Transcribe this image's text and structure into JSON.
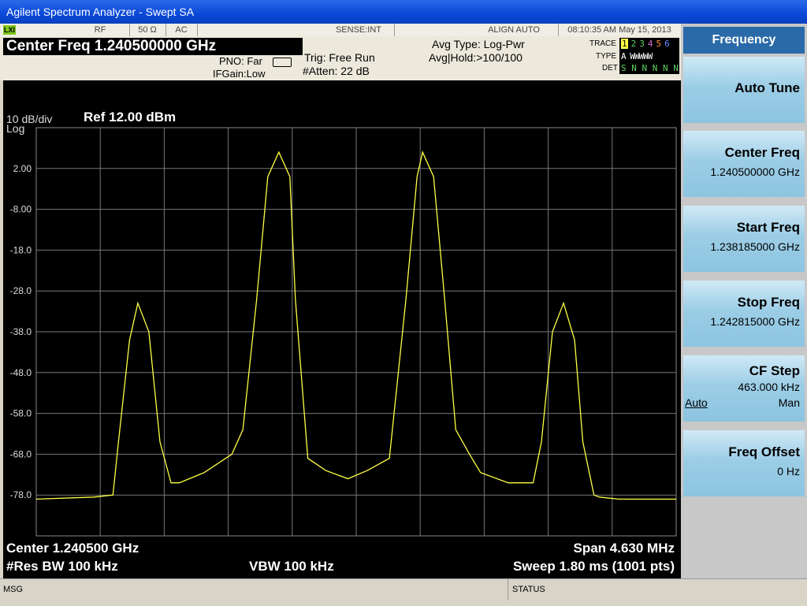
{
  "window": {
    "title": "Agilent Spectrum Analyzer - Swept SA"
  },
  "status_row": {
    "lxi": "LXI",
    "rf": "RF",
    "impedance": "50 Ω",
    "coupling": "AC",
    "sense": "SENSE:INT",
    "align": "ALIGN AUTO",
    "datetime": "08:10:35 AM May 15, 2013"
  },
  "info": {
    "center_freq": "Center Freq  1.240500000 GHz",
    "pno": "PNO: Far",
    "ifgain": "IFGain:Low",
    "trig": "Trig: Free Run",
    "atten": "#Atten: 22 dB",
    "avg_type": "Avg Type: Log-Pwr",
    "avg_hold": "Avg|Hold:>100/100",
    "trace_label": "TRACE",
    "type_label": "TYPE",
    "det_label": "DET",
    "trace_nums": [
      "1",
      "2",
      "3",
      "4",
      "5",
      "6"
    ],
    "type_row": "A WWWWW",
    "det_row": "S N N N N N"
  },
  "display": {
    "scale": "10 dB/div",
    "scale_type": "Log",
    "ref": "Ref 12.00 dBm",
    "center": "Center 1.240500 GHz",
    "res_bw": "#Res BW 100 kHz",
    "vbw": "VBW 100 kHz",
    "span": "Span 4.630 MHz",
    "sweep": "Sweep  1.80 ms (1001 pts)"
  },
  "chart_data": {
    "type": "line",
    "title": "",
    "xlabel": "",
    "ylabel": "",
    "x_range_mhz": [
      -2.315,
      2.315
    ],
    "ylim": [
      -88,
      12
    ],
    "ytick_labels": [
      "2.00",
      "-8.00",
      "-18.0",
      "-28.0",
      "-38.0",
      "-48.0",
      "-58.0",
      "-68.0",
      "-78.0"
    ],
    "yticks": [
      2,
      -8,
      -18,
      -28,
      -38,
      -48,
      -58,
      -68,
      -78
    ],
    "series": [
      {
        "color": "#ffff44",
        "x": [
          -2.315,
          -1.9,
          -1.76,
          -1.72,
          -1.64,
          -1.58,
          -1.5,
          -1.42,
          -1.34,
          -1.28,
          -1.1,
          -0.9,
          -0.82,
          -0.72,
          -0.64,
          -0.56,
          -0.48,
          -0.44,
          -0.35,
          -0.22,
          -0.06,
          0.08,
          0.24,
          0.36,
          0.44,
          0.48,
          0.56,
          0.64,
          0.72,
          0.82,
          0.9,
          1.1,
          1.28,
          1.34,
          1.42,
          1.5,
          1.58,
          1.64,
          1.72,
          1.76,
          1.9,
          2.315
        ],
        "y": [
          -79,
          -78.5,
          -78,
          -65,
          -40,
          -31,
          -38,
          -65,
          -75,
          -75,
          -72.5,
          -68,
          -62,
          -30,
          0,
          6,
          0,
          -30,
          -69,
          -72,
          -74,
          -72,
          -69,
          -30,
          0,
          6,
          0,
          -30,
          -62,
          -68,
          -72.5,
          -75,
          -75,
          -65,
          -38,
          -31,
          -40,
          -65,
          -78,
          -78.5,
          -79,
          -79
        ]
      }
    ]
  },
  "softkeys": {
    "header": "Frequency",
    "auto_tune": "Auto Tune",
    "center_freq_label": "Center Freq",
    "center_freq_value": "1.240500000 GHz",
    "start_freq_label": "Start Freq",
    "start_freq_value": "1.238185000 GHz",
    "stop_freq_label": "Stop Freq",
    "stop_freq_value": "1.242815000 GHz",
    "cf_step_label": "CF Step",
    "cf_step_value": "463.000 kHz",
    "cf_step_auto": "Auto",
    "cf_step_man": "Man",
    "freq_offset_label": "Freq Offset",
    "freq_offset_value": "0 Hz"
  },
  "msgbar": {
    "msg": "MSG",
    "status": "STATUS"
  }
}
